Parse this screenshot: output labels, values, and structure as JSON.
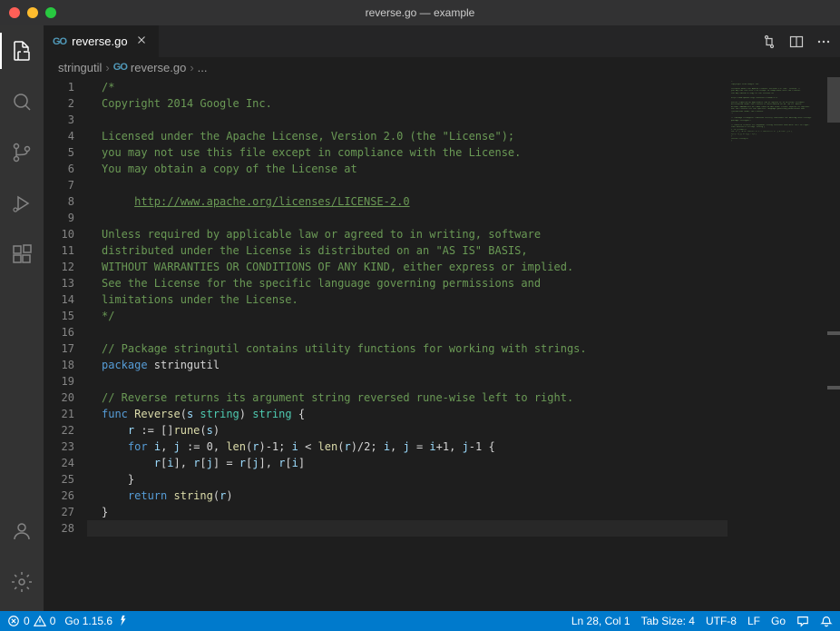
{
  "window": {
    "title": "reverse.go — example"
  },
  "tab": {
    "filename": "reverse.go",
    "icon": "GO"
  },
  "breadcrumb": {
    "segments": [
      "stringutil",
      "reverse.go",
      "..."
    ]
  },
  "code": {
    "lines": [
      {
        "n": 1,
        "raw": "/*",
        "tokens": [
          {
            "c": "c-comment",
            "t": "/*"
          }
        ]
      },
      {
        "n": 2,
        "raw": "Copyright 2014 Google Inc.",
        "tokens": [
          {
            "c": "c-comment",
            "t": "Copyright 2014 Google Inc."
          }
        ]
      },
      {
        "n": 3,
        "raw": "",
        "tokens": []
      },
      {
        "n": 4,
        "raw": "Licensed under the Apache License, Version 2.0 (the \"License\");",
        "tokens": [
          {
            "c": "c-comment",
            "t": "Licensed under the Apache License, Version 2.0 (the \"License\");"
          }
        ]
      },
      {
        "n": 5,
        "raw": "you may not use this file except in compliance with the License.",
        "tokens": [
          {
            "c": "c-comment",
            "t": "you may not use this file except in compliance with the License."
          }
        ]
      },
      {
        "n": 6,
        "raw": "You may obtain a copy of the License at",
        "tokens": [
          {
            "c": "c-comment",
            "t": "You may obtain a copy of the License at"
          }
        ]
      },
      {
        "n": 7,
        "raw": "",
        "tokens": []
      },
      {
        "n": 8,
        "raw": "     http://www.apache.org/licenses/LICENSE-2.0",
        "tokens": [
          {
            "c": "",
            "t": "     "
          },
          {
            "c": "c-link",
            "t": "http://www.apache.org/licenses/LICENSE-2.0"
          }
        ],
        "indent": true
      },
      {
        "n": 9,
        "raw": "",
        "tokens": []
      },
      {
        "n": 10,
        "raw": "Unless required by applicable law or agreed to in writing, software",
        "tokens": [
          {
            "c": "c-comment",
            "t": "Unless required by applicable law or agreed to in writing, software"
          }
        ]
      },
      {
        "n": 11,
        "raw": "distributed under the License is distributed on an \"AS IS\" BASIS,",
        "tokens": [
          {
            "c": "c-comment",
            "t": "distributed under the License is distributed on an \"AS IS\" BASIS,"
          }
        ]
      },
      {
        "n": 12,
        "raw": "WITHOUT WARRANTIES OR CONDITIONS OF ANY KIND, either express or implied.",
        "tokens": [
          {
            "c": "c-comment",
            "t": "WITHOUT WARRANTIES OR CONDITIONS OF ANY KIND, either express or implied."
          }
        ]
      },
      {
        "n": 13,
        "raw": "See the License for the specific language governing permissions and",
        "tokens": [
          {
            "c": "c-comment",
            "t": "See the License for the specific language governing permissions and"
          }
        ]
      },
      {
        "n": 14,
        "raw": "limitations under the License.",
        "tokens": [
          {
            "c": "c-comment",
            "t": "limitations under the License."
          }
        ]
      },
      {
        "n": 15,
        "raw": "*/",
        "tokens": [
          {
            "c": "c-comment",
            "t": "*/"
          }
        ]
      },
      {
        "n": 16,
        "raw": "",
        "tokens": []
      },
      {
        "n": 17,
        "raw": "// Package stringutil contains utility functions for working with strings.",
        "tokens": [
          {
            "c": "c-comment",
            "t": "// Package stringutil contains utility functions for working with strings."
          }
        ]
      },
      {
        "n": 18,
        "raw": "package stringutil",
        "tokens": [
          {
            "c": "c-keyword",
            "t": "package"
          },
          {
            "c": "c-op",
            "t": " stringutil"
          }
        ]
      },
      {
        "n": 19,
        "raw": "",
        "tokens": []
      },
      {
        "n": 20,
        "raw": "// Reverse returns its argument string reversed rune-wise left to right.",
        "tokens": [
          {
            "c": "c-comment",
            "t": "// Reverse returns its argument string reversed rune-wise left to right."
          }
        ]
      },
      {
        "n": 21,
        "raw": "func Reverse(s string) string {",
        "tokens": [
          {
            "c": "c-keyword",
            "t": "func"
          },
          {
            "c": "c-op",
            "t": " "
          },
          {
            "c": "c-func",
            "t": "Reverse"
          },
          {
            "c": "c-op",
            "t": "("
          },
          {
            "c": "c-var",
            "t": "s"
          },
          {
            "c": "c-op",
            "t": " "
          },
          {
            "c": "c-type",
            "t": "string"
          },
          {
            "c": "c-op",
            "t": ") "
          },
          {
            "c": "c-type",
            "t": "string"
          },
          {
            "c": "c-op",
            "t": " {"
          }
        ]
      },
      {
        "n": 22,
        "raw": "    r := []rune(s)",
        "tokens": [
          {
            "c": "c-op",
            "t": "    "
          },
          {
            "c": "c-var",
            "t": "r"
          },
          {
            "c": "c-op",
            "t": " := []"
          },
          {
            "c": "c-func",
            "t": "rune"
          },
          {
            "c": "c-op",
            "t": "("
          },
          {
            "c": "c-var",
            "t": "s"
          },
          {
            "c": "c-op",
            "t": ")"
          }
        ],
        "indent": true
      },
      {
        "n": 23,
        "raw": "    for i, j := 0, len(r)-1; i < len(r)/2; i, j = i+1, j-1 {",
        "tokens": [
          {
            "c": "c-op",
            "t": "    "
          },
          {
            "c": "c-keyword",
            "t": "for"
          },
          {
            "c": "c-op",
            "t": " "
          },
          {
            "c": "c-var",
            "t": "i"
          },
          {
            "c": "c-op",
            "t": ", "
          },
          {
            "c": "c-var",
            "t": "j"
          },
          {
            "c": "c-op",
            "t": " := 0, "
          },
          {
            "c": "c-func",
            "t": "len"
          },
          {
            "c": "c-op",
            "t": "("
          },
          {
            "c": "c-var",
            "t": "r"
          },
          {
            "c": "c-op",
            "t": ")-1; "
          },
          {
            "c": "c-var",
            "t": "i"
          },
          {
            "c": "c-op",
            "t": " < "
          },
          {
            "c": "c-func",
            "t": "len"
          },
          {
            "c": "c-op",
            "t": "("
          },
          {
            "c": "c-var",
            "t": "r"
          },
          {
            "c": "c-op",
            "t": ")/2; "
          },
          {
            "c": "c-var",
            "t": "i"
          },
          {
            "c": "c-op",
            "t": ", "
          },
          {
            "c": "c-var",
            "t": "j"
          },
          {
            "c": "c-op",
            "t": " = "
          },
          {
            "c": "c-var",
            "t": "i"
          },
          {
            "c": "c-op",
            "t": "+1, "
          },
          {
            "c": "c-var",
            "t": "j"
          },
          {
            "c": "c-op",
            "t": "-1 {"
          }
        ],
        "indent": true
      },
      {
        "n": 24,
        "raw": "        r[i], r[j] = r[j], r[i]",
        "tokens": [
          {
            "c": "c-op",
            "t": "        "
          },
          {
            "c": "c-var",
            "t": "r"
          },
          {
            "c": "c-op",
            "t": "["
          },
          {
            "c": "c-var",
            "t": "i"
          },
          {
            "c": "c-op",
            "t": "], "
          },
          {
            "c": "c-var",
            "t": "r"
          },
          {
            "c": "c-op",
            "t": "["
          },
          {
            "c": "c-var",
            "t": "j"
          },
          {
            "c": "c-op",
            "t": "] = "
          },
          {
            "c": "c-var",
            "t": "r"
          },
          {
            "c": "c-op",
            "t": "["
          },
          {
            "c": "c-var",
            "t": "j"
          },
          {
            "c": "c-op",
            "t": "], "
          },
          {
            "c": "c-var",
            "t": "r"
          },
          {
            "c": "c-op",
            "t": "["
          },
          {
            "c": "c-var",
            "t": "i"
          },
          {
            "c": "c-op",
            "t": "]"
          }
        ],
        "indent": true
      },
      {
        "n": 25,
        "raw": "    }",
        "tokens": [
          {
            "c": "c-op",
            "t": "    }"
          }
        ],
        "indent": true
      },
      {
        "n": 26,
        "raw": "    return string(r)",
        "tokens": [
          {
            "c": "c-op",
            "t": "    "
          },
          {
            "c": "c-keyword",
            "t": "return"
          },
          {
            "c": "c-op",
            "t": " "
          },
          {
            "c": "c-func",
            "t": "string"
          },
          {
            "c": "c-op",
            "t": "("
          },
          {
            "c": "c-var",
            "t": "r"
          },
          {
            "c": "c-op",
            "t": ")"
          }
        ],
        "indent": true
      },
      {
        "n": 27,
        "raw": "}",
        "tokens": [
          {
            "c": "c-op",
            "t": "}"
          }
        ]
      },
      {
        "n": 28,
        "raw": "",
        "tokens": [],
        "current": true
      }
    ]
  },
  "status": {
    "errors": "0",
    "warnings": "0",
    "go_version": "Go 1.15.6",
    "cursor": "Ln 28, Col 1",
    "tab_size": "Tab Size: 4",
    "encoding": "UTF-8",
    "eol": "LF",
    "language": "Go"
  }
}
